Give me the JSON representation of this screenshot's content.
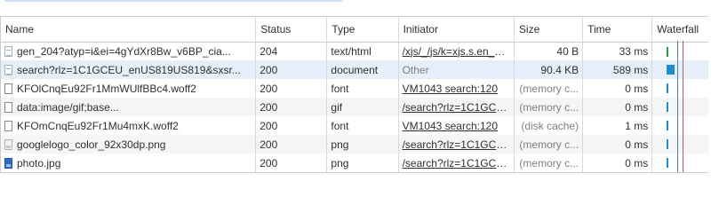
{
  "columns": {
    "name": "Name",
    "status": "Status",
    "type": "Type",
    "initiator": "Initiator",
    "size": "Size",
    "time": "Time",
    "waterfall": "Waterfall"
  },
  "rows": [
    {
      "name": "gen_204?atyp=i&ei=4gYdXr8Bw_v6BP_cia...",
      "status": "204",
      "type": "text/html",
      "initiator": "/xjs/_/js/k=xjs.s.en_U...",
      "initiator_link": true,
      "size": "40 B",
      "size_muted": false,
      "time": "33 ms",
      "icon": "document-icon",
      "wf_color": "#2ea043",
      "wf_width_fraction": 0.04
    },
    {
      "name": "search?rlz=1C1GCEU_enUS819US819&sxsr...",
      "status": "200",
      "type": "document",
      "initiator": "Other",
      "initiator_link": false,
      "size": "90.4 KB",
      "size_muted": false,
      "time": "589 ms",
      "icon": "document-icon",
      "wf_color": "#1a8fd6",
      "wf_width_fraction": 0.18
    },
    {
      "name": "KFOlCnqEu92Fr1MmWUlfBBc4.woff2",
      "status": "200",
      "type": "font",
      "initiator": "VM1043 search:120",
      "initiator_link": true,
      "size": "(memory c...",
      "size_muted": true,
      "time": "0 ms",
      "icon": "file-icon",
      "wf_color": "#1a8fd6",
      "wf_width_fraction": 0.04
    },
    {
      "name": "data:image/gif;base...",
      "status": "200",
      "type": "gif",
      "initiator": "/search?rlz=1C1GCE...",
      "initiator_link": true,
      "size": "(memory c...",
      "size_muted": true,
      "time": "0 ms",
      "icon": "file-icon",
      "wf_color": "#1a8fd6",
      "wf_width_fraction": 0.04
    },
    {
      "name": "KFOmCnqEu92Fr1Mu4mxK.woff2",
      "status": "200",
      "type": "font",
      "initiator": "VM1043 search:120",
      "initiator_link": true,
      "size": "(disk cache)",
      "size_muted": true,
      "time": "1 ms",
      "icon": "file-icon",
      "wf_color": "#1a8fd6",
      "wf_width_fraction": 0.04
    },
    {
      "name": "googlelogo_color_92x30dp.png",
      "status": "200",
      "type": "png",
      "initiator": "/search?rlz=1C1GCE...",
      "initiator_link": true,
      "size": "(memory c...",
      "size_muted": true,
      "time": "0 ms",
      "icon": "image-icon",
      "wf_color": "#1a8fd6",
      "wf_width_fraction": 0.04
    },
    {
      "name": "photo.jpg",
      "status": "200",
      "type": "png",
      "initiator": "/search?rlz=1C1GCE...",
      "initiator_link": true,
      "size": "(memory c...",
      "size_muted": true,
      "time": "0 ms",
      "icon": "photo-icon",
      "wf_color": "#1a8fd6",
      "wf_width_fraction": 0.04
    }
  ],
  "selected_row": 1,
  "colors": {
    "selected_row_bg": "#e6eefa",
    "stripe_bg": "#f5f5f5",
    "dom_content_loaded_line": "#4a7fd0",
    "load_line": "#c05a5a"
  }
}
